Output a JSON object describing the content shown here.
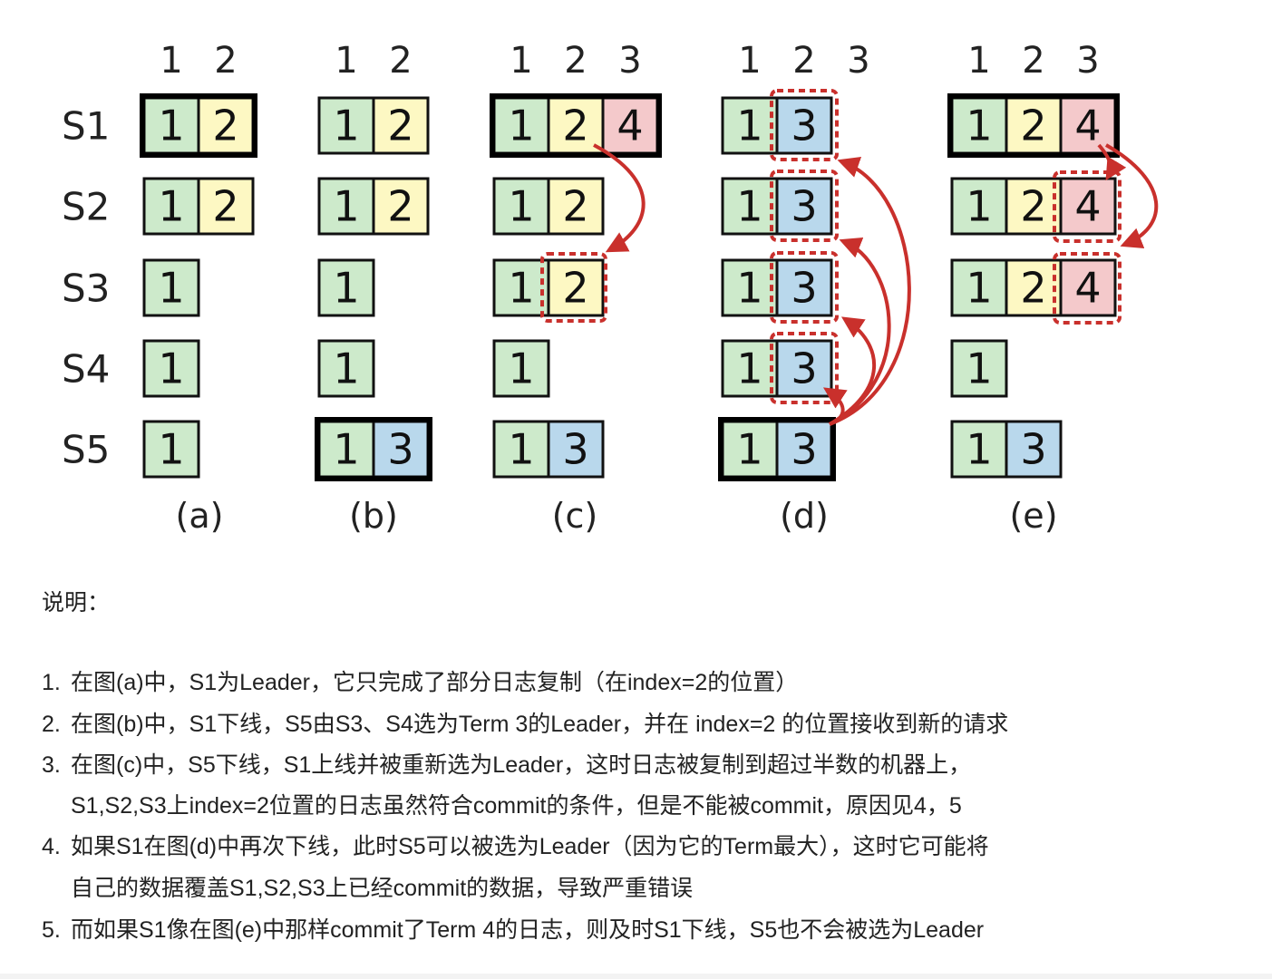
{
  "diagram": {
    "rows": [
      "S1",
      "S2",
      "S3",
      "S4",
      "S5"
    ],
    "index_headers": {
      "a": [
        "1",
        "2"
      ],
      "b": [
        "1",
        "2"
      ],
      "c": [
        "1",
        "2",
        "3"
      ],
      "d": [
        "1",
        "2",
        "3"
      ],
      "e": [
        "1",
        "2",
        "3"
      ]
    },
    "captions": [
      "(a)",
      "(b)",
      "(c)",
      "(d)",
      "(e)"
    ],
    "term_colors": {
      "1": "#cdeacb",
      "2": "#fdf8c3",
      "3": "#b9d8ec",
      "4": "#f4c9cb"
    },
    "arrow_color": "#c9302c",
    "panels": [
      {
        "id": "a",
        "leader": "S1",
        "logs": [
          [
            "1",
            "2"
          ],
          [
            "1",
            "2"
          ],
          [
            "1"
          ],
          [
            "1"
          ],
          [
            "1"
          ]
        ]
      },
      {
        "id": "b",
        "leader": "S5",
        "logs": [
          [
            "1",
            "2"
          ],
          [
            "1",
            "2"
          ],
          [
            "1"
          ],
          [
            "1"
          ],
          [
            "1",
            "3"
          ]
        ]
      },
      {
        "id": "c",
        "leader": "S1",
        "logs": [
          [
            "1",
            "2",
            "4"
          ],
          [
            "1",
            "2"
          ],
          [
            "1",
            "2"
          ],
          [
            "1"
          ],
          [
            "1",
            "3"
          ]
        ]
      },
      {
        "id": "d",
        "leader": "S5",
        "logs": [
          [
            "1",
            "3"
          ],
          [
            "1",
            "3"
          ],
          [
            "1",
            "3"
          ],
          [
            "1",
            "3"
          ],
          [
            "1",
            "3"
          ]
        ]
      },
      {
        "id": "e",
        "leader": "S1",
        "logs": [
          [
            "1",
            "2",
            "4"
          ],
          [
            "1",
            "2",
            "4"
          ],
          [
            "1",
            "2",
            "4"
          ],
          [
            "1"
          ],
          [
            "1",
            "3"
          ]
        ]
      }
    ]
  },
  "explanation": {
    "title": "说明：",
    "items": [
      {
        "num": "1.",
        "lines": [
          "在图(a)中，S1为Leader，它只完成了部分日志复制（在index=2的位置）"
        ]
      },
      {
        "num": "2.",
        "lines": [
          "在图(b)中，S1下线，S5由S3、S4选为Term 3的Leader，并在 index=2 的位置接收到新的请求"
        ]
      },
      {
        "num": "3.",
        "lines": [
          "在图(c)中，S5下线，S1上线并被重新选为Leader，这时日志被复制到超过半数的机器上，",
          "S1,S2,S3上index=2位置的日志虽然符合commit的条件，但是不能被commit，原因见4，5"
        ]
      },
      {
        "num": "4.",
        "lines": [
          "如果S1在图(d)中再次下线，此时S5可以被选为Leader（因为它的Term最大），这时它可能将",
          "自己的数据覆盖S1,S2,S3上已经commit的数据，导致严重错误"
        ]
      },
      {
        "num": "5.",
        "lines": [
          "而如果S1像在图(e)中那样commit了Term 4的日志，则及时S1下线，S5也不会被选为Leader"
        ]
      }
    ]
  }
}
